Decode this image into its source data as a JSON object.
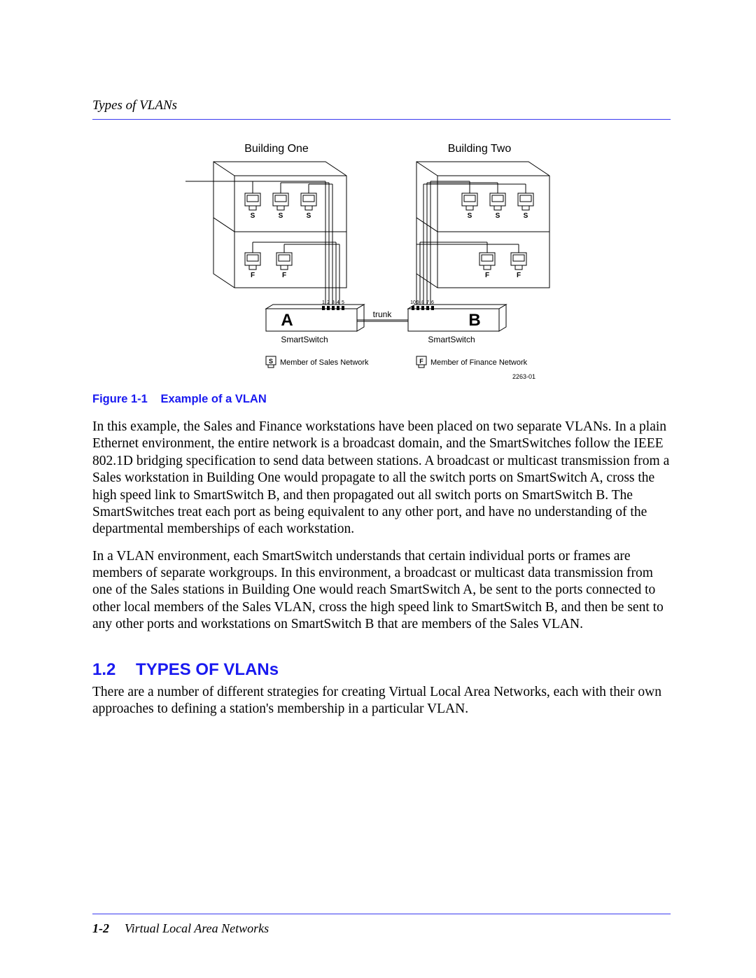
{
  "header": {
    "section_running": "Types of VLANs"
  },
  "figure": {
    "buildings": {
      "b1_label": "Building One",
      "b2_label": "Building Two"
    },
    "ws_labels": {
      "S": "S",
      "F": "F"
    },
    "switches": {
      "A": "A",
      "B": "B",
      "trunk": "trunk",
      "sublabel": "SmartSwitch",
      "ports_a": [
        "1",
        "2",
        "3",
        "4",
        "5"
      ],
      "ports_b": [
        "10",
        "9",
        "8",
        "7",
        "6"
      ]
    },
    "legend": {
      "sales": "Member of Sales Network",
      "finance": "Member of Finance Network"
    },
    "figure_id": "2263-01",
    "caption_label": "Figure 1-1",
    "caption_text": "Example of a VLAN"
  },
  "paragraphs": {
    "p1": "In this example, the Sales and Finance workstations have been placed on two separate VLANs. In a plain Ethernet environment, the entire network is a broadcast domain, and the SmartSwitches follow the IEEE 802.1D bridging specification to send data between stations. A broadcast or multicast transmission from a Sales workstation in Building One would propagate to all the switch ports on SmartSwitch A, cross the high speed link to SmartSwitch B, and then propagated out all switch ports on SmartSwitch B. The SmartSwitches treat each port as being equivalent to any other port, and have no understanding of the departmental memberships of each workstation.",
    "p2": "In a VLAN environment, each SmartSwitch understands that certain individual ports or frames are members of separate workgroups. In this environment, a broadcast or multicast data transmission from one of the Sales stations in Building One would reach SmartSwitch A, be sent to the ports connected to other local members of the Sales VLAN, cross the high speed link to SmartSwitch B, and then be sent to any other ports and workstations on SmartSwitch B that are members of the Sales VLAN."
  },
  "section": {
    "num": "1.2",
    "title": "TYPES OF VLANs",
    "intro": "There are a number of different strategies for creating Virtual Local Area Networks, each with their own approaches to defining a station's membership in a particular VLAN."
  },
  "footer": {
    "page_num": "1-2",
    "doc_title": "Virtual Local Area Networks"
  }
}
